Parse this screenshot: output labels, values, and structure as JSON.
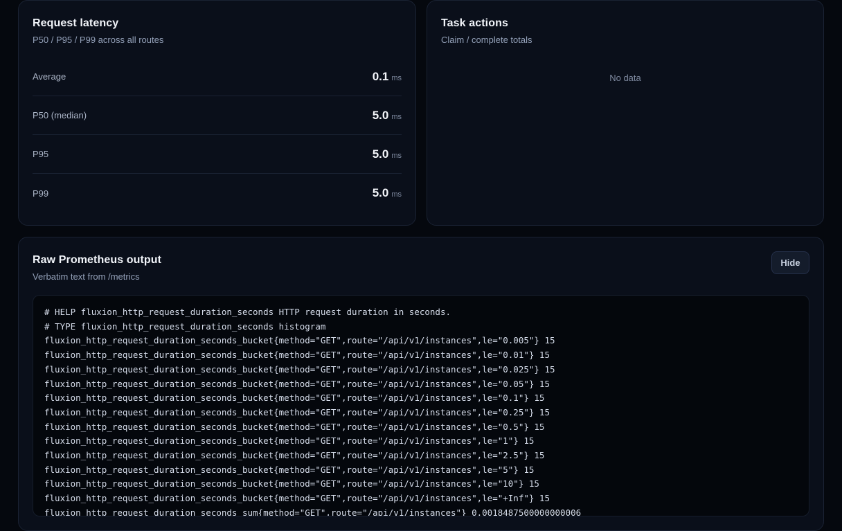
{
  "latency": {
    "title": "Request latency",
    "subtitle": "P50 / P95 / P99 across all routes",
    "rows": [
      {
        "label": "Average",
        "value": "0.1",
        "unit": "ms"
      },
      {
        "label": "P50 (median)",
        "value": "5.0",
        "unit": "ms"
      },
      {
        "label": "P95",
        "value": "5.0",
        "unit": "ms"
      },
      {
        "label": "P99",
        "value": "5.0",
        "unit": "ms"
      }
    ]
  },
  "task_actions": {
    "title": "Task actions",
    "subtitle": "Claim / complete totals",
    "empty_text": "No data"
  },
  "raw_output": {
    "title": "Raw Prometheus output",
    "subtitle": "Verbatim text from /metrics",
    "hide_label": "Hide",
    "lines": [
      "# HELP fluxion_http_request_duration_seconds HTTP request duration in seconds.",
      "# TYPE fluxion_http_request_duration_seconds histogram",
      "fluxion_http_request_duration_seconds_bucket{method=\"GET\",route=\"/api/v1/instances\",le=\"0.005\"} 15",
      "fluxion_http_request_duration_seconds_bucket{method=\"GET\",route=\"/api/v1/instances\",le=\"0.01\"} 15",
      "fluxion_http_request_duration_seconds_bucket{method=\"GET\",route=\"/api/v1/instances\",le=\"0.025\"} 15",
      "fluxion_http_request_duration_seconds_bucket{method=\"GET\",route=\"/api/v1/instances\",le=\"0.05\"} 15",
      "fluxion_http_request_duration_seconds_bucket{method=\"GET\",route=\"/api/v1/instances\",le=\"0.1\"} 15",
      "fluxion_http_request_duration_seconds_bucket{method=\"GET\",route=\"/api/v1/instances\",le=\"0.25\"} 15",
      "fluxion_http_request_duration_seconds_bucket{method=\"GET\",route=\"/api/v1/instances\",le=\"0.5\"} 15",
      "fluxion_http_request_duration_seconds_bucket{method=\"GET\",route=\"/api/v1/instances\",le=\"1\"} 15",
      "fluxion_http_request_duration_seconds_bucket{method=\"GET\",route=\"/api/v1/instances\",le=\"2.5\"} 15",
      "fluxion_http_request_duration_seconds_bucket{method=\"GET\",route=\"/api/v1/instances\",le=\"5\"} 15",
      "fluxion_http_request_duration_seconds_bucket{method=\"GET\",route=\"/api/v1/instances\",le=\"10\"} 15",
      "fluxion_http_request_duration_seconds_bucket{method=\"GET\",route=\"/api/v1/instances\",le=\"+Inf\"} 15",
      "fluxion_http_request_duration_seconds_sum{method=\"GET\",route=\"/api/v1/instances\"} 0.0018487500000000006"
    ]
  }
}
